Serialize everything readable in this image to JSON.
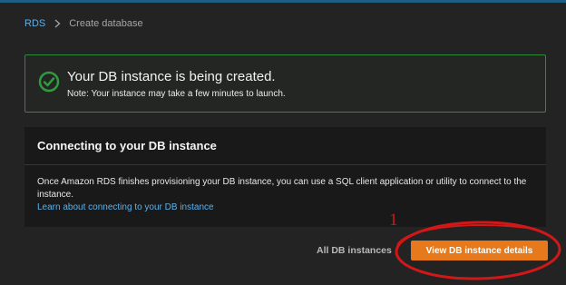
{
  "breadcrumb": {
    "root": "RDS",
    "current": "Create database"
  },
  "success_alert": {
    "title": "Your DB instance is being created.",
    "note": "Note: Your instance may take a few minutes to launch.",
    "icon": "check-circle-icon",
    "color": "#2f9a3e"
  },
  "connect_panel": {
    "title": "Connecting to your DB instance",
    "body": "Once Amazon RDS finishes provisioning your DB instance, you can use a SQL client application or utility to connect to the instance.",
    "link": "Learn about connecting to your DB instance"
  },
  "actions": {
    "all_instances": "All DB instances",
    "view_details": "View DB instance details",
    "primary_color": "#e5791b"
  },
  "annotation": {
    "number": "1",
    "color": "#d01818"
  }
}
